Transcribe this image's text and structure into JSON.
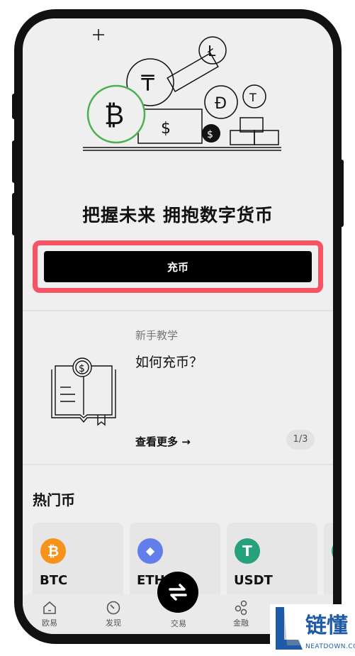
{
  "slogan": "把握未来 拥抱数字货币",
  "cta": {
    "label": "充币"
  },
  "tutorial": {
    "subtitle": "新手教学",
    "title": "如何充币？",
    "more": "查看更多 →",
    "pager": "1/3"
  },
  "hot": {
    "title": "热门币",
    "coins": [
      {
        "symbol": "BTC",
        "glyph": "₿",
        "color": "#f7931a"
      },
      {
        "symbol": "ETH",
        "glyph": "◆",
        "color": "#627eea"
      },
      {
        "symbol": "USDT",
        "glyph": "T",
        "color": "#26a17b"
      }
    ]
  },
  "nav": {
    "items": [
      {
        "label": "欧易",
        "icon": "home-icon"
      },
      {
        "label": "发现",
        "icon": "discover-icon"
      },
      {
        "label": "交易",
        "icon": "swap-icon"
      },
      {
        "label": "金融",
        "icon": "finance-icon"
      }
    ]
  },
  "watermark": {
    "brand": "链懂",
    "domain": "NEATDOWN.COM"
  },
  "colors": {
    "highlight": "#f65366",
    "btc": "#f7931a",
    "eth": "#627eea",
    "usdt": "#26a17b",
    "btc_ring": "#4caf50"
  }
}
